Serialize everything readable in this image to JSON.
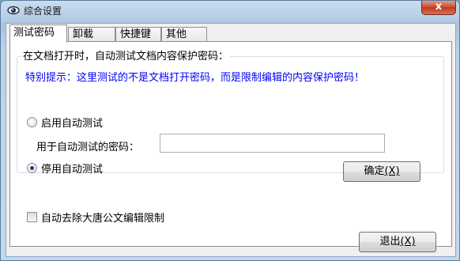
{
  "window": {
    "title": "综合设置",
    "close_label": "x"
  },
  "tabs": [
    {
      "label": "测试密码",
      "active": true
    },
    {
      "label": "卸载",
      "active": false
    },
    {
      "label": "快捷键",
      "active": false
    },
    {
      "label": "其他",
      "active": false
    }
  ],
  "group": {
    "label": "在文档打开时，自动测试文档内容保护密码：",
    "hint": "特别提示：这里测试的不是文档打开密码，而是限制编辑的内容保护密码！",
    "hint_color": "#0000ff",
    "enable_option": {
      "label": "启用自动测试",
      "checked": false
    },
    "password": {
      "label": "用于自动测试的密码：",
      "value": ""
    },
    "disable_option": {
      "label": "停用自动测试",
      "checked": true
    },
    "ok_button": {
      "label": "确定",
      "hotkey": "(X)"
    }
  },
  "remove_limit": {
    "label": "自动去除大唐公文编辑限制",
    "checked": false
  },
  "exit_button": {
    "label": "退出",
    "hotkey": "(X)"
  }
}
